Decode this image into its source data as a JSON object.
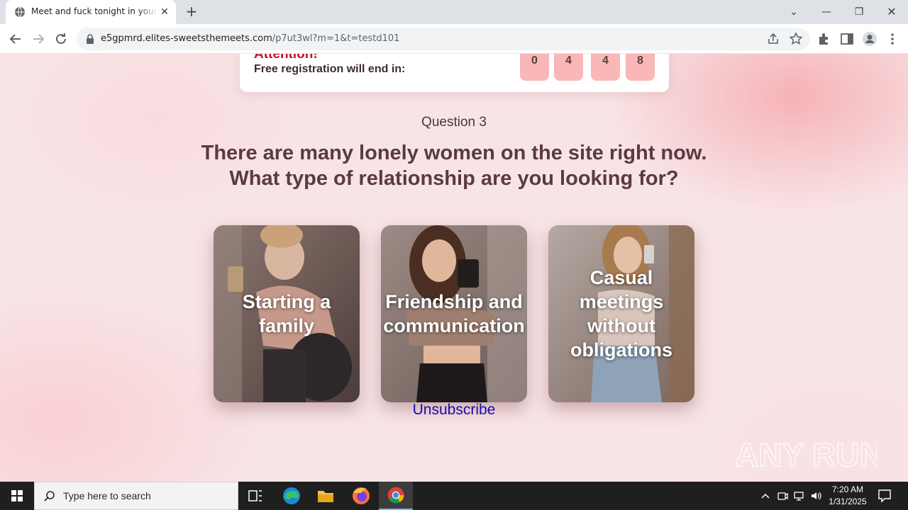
{
  "browser": {
    "tab_title": "Meet and fuck tonight in your area",
    "url_host": "e5gpmrd.elites-sweetsthemeets.com",
    "url_path": "/p7ut3wl?m=1&t=testd101"
  },
  "page": {
    "attention": "Attention!",
    "registration_text": "Free registration will end in:",
    "countdown": [
      "0",
      "4",
      "4",
      "8"
    ],
    "question_number": "Question 3",
    "headline_line1": "There are many lonely women on the site right now.",
    "headline_line2": "What type of relationship are you looking for?",
    "options": [
      {
        "line1": "Starting a",
        "line2": "family",
        "line3": "",
        "line4": ""
      },
      {
        "line1": "Friendship and",
        "line2": "communication",
        "line3": "",
        "line4": ""
      },
      {
        "line1": "Casual",
        "line2": "meetings",
        "line3": "without",
        "line4": "obligations"
      }
    ],
    "unsubscribe": "Unsubscribe",
    "watermark": "ANY RUN"
  },
  "taskbar": {
    "search_placeholder": "Type here to search",
    "time": "7:20 AM",
    "date": "1/31/2025"
  },
  "colors": {
    "accent_red": "#c8102e",
    "digit_bg": "#f9b7b8",
    "link": "#1a0dab",
    "headline": "#5b3a42"
  }
}
